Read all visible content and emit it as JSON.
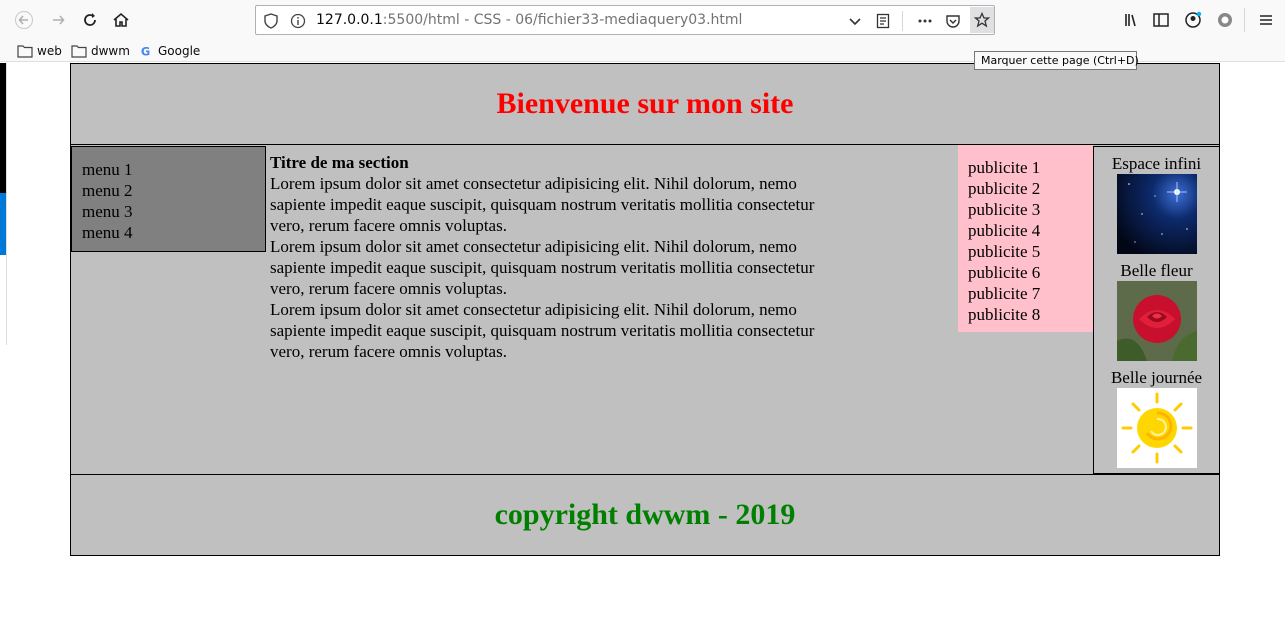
{
  "browser": {
    "url_host": "127.0.0.1",
    "url_rest": ":5500/html - CSS - 06/fichier33-mediaquery03.html",
    "tooltip": "Marquer cette page (Ctrl+D)",
    "bookmarks": [
      {
        "label": "web",
        "icon": "folder-icon"
      },
      {
        "label": "dwwm",
        "icon": "folder-icon"
      },
      {
        "label": "Google",
        "icon": "google-icon"
      }
    ]
  },
  "site": {
    "title": "Bienvenue sur mon site",
    "menu": [
      "menu 1",
      "menu 2",
      "menu 3",
      "menu 4"
    ],
    "section_title": "Titre de ma section",
    "paragraphs": [
      "Lorem ipsum dolor sit amet consectetur adipisicing elit. Nihil dolorum, nemo sapiente impedit eaque suscipit, quisquam nostrum veritatis mollitia consectetur vero, rerum facere omnis voluptas.",
      "Lorem ipsum dolor sit amet consectetur adipisicing elit. Nihil dolorum, nemo sapiente impedit eaque suscipit, quisquam nostrum veritatis mollitia consectetur vero, rerum facere omnis voluptas.",
      "Lorem ipsum dolor sit amet consectetur adipisicing elit. Nihil dolorum, nemo sapiente impedit eaque suscipit, quisquam nostrum veritatis mollitia consectetur vero, rerum facere omnis voluptas."
    ],
    "pubs": [
      "publicite 1",
      "publicite 2",
      "publicite 3",
      "publicite 4",
      "publicite 5",
      "publicite 6",
      "publicite 7",
      "publicite 8"
    ],
    "aside_items": [
      {
        "caption": "Espace infini",
        "image": "space-image"
      },
      {
        "caption": "Belle fleur",
        "image": "rose-image"
      },
      {
        "caption": "Belle journée",
        "image": "sun-image"
      }
    ],
    "footer": "copyright dwwm - 2019"
  },
  "colors": {
    "title": "#ff0000",
    "footer": "#008000",
    "block_bg": "#c0c0c0",
    "menu_bg": "#808080",
    "pubs_bg": "#ffc0cb"
  }
}
